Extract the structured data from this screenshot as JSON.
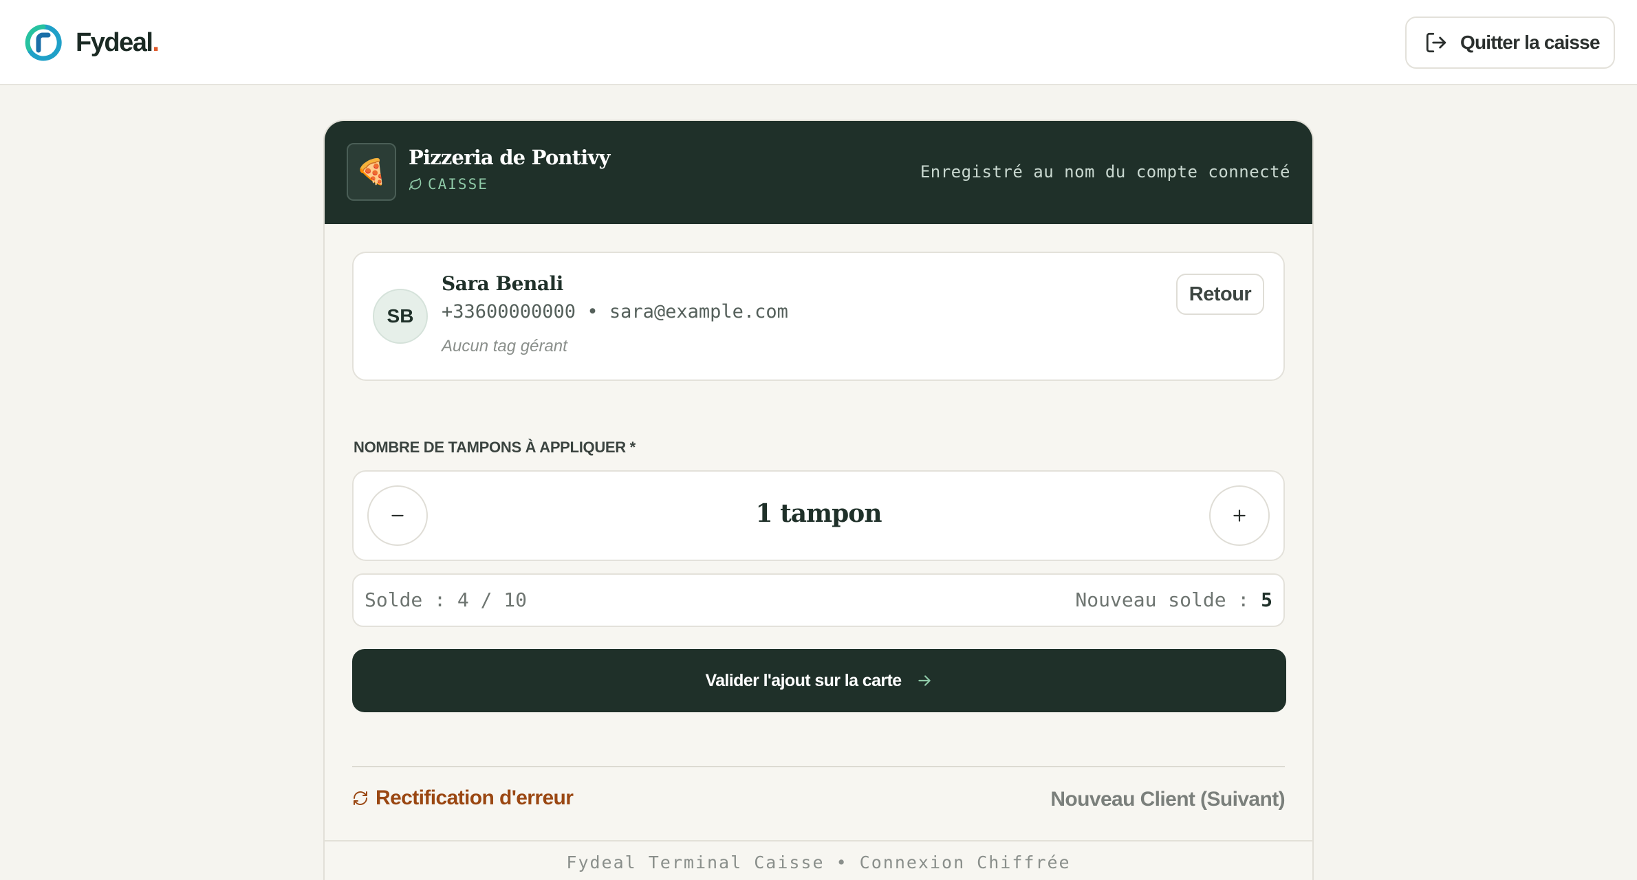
{
  "app": {
    "brand_name": "Fydeal",
    "brand_dot": ".",
    "quit_label": "Quitter la caisse"
  },
  "header": {
    "shop_name": "Pizzeria de Pontivy",
    "shop_icon": "🍕",
    "shop_sub": "CAISSE",
    "note": "Enregistré au nom du compte connecté"
  },
  "customer": {
    "initials": "SB",
    "name": "Sara Benali",
    "contact": "+33600000000 • sara@example.com",
    "tags": "Aucun tag gérant",
    "back_label": "Retour"
  },
  "stamps": {
    "label": "NOMBRE DE TAMPONS À APPLIQUER *",
    "value": "1 tampon"
  },
  "balance": {
    "current": "Solde : 4 / 10",
    "new_label": "Nouveau solde : ",
    "new_value": "5"
  },
  "actions": {
    "validate_label": "Valider l'ajout sur la carte",
    "rectify_label": "Rectification d'erreur",
    "next_label": "Nouveau Client (Suivant)"
  },
  "footer": {
    "text": "Fydeal Terminal Caisse • Connexion Chiffrée"
  },
  "colors": {
    "primary": "#1f3029",
    "accent_orange": "#e05a2b",
    "rectify": "#9a4712",
    "sub_green": "#8fcaa8"
  },
  "icons": {
    "logo": "fydeal-logo-icon",
    "quit": "logout-icon",
    "shop": "pizza-icon",
    "sub": "leaf-icon",
    "minus": "minus-icon",
    "plus": "plus-icon",
    "validate": "arrow-right-icon",
    "rectify": "refresh-icon"
  }
}
